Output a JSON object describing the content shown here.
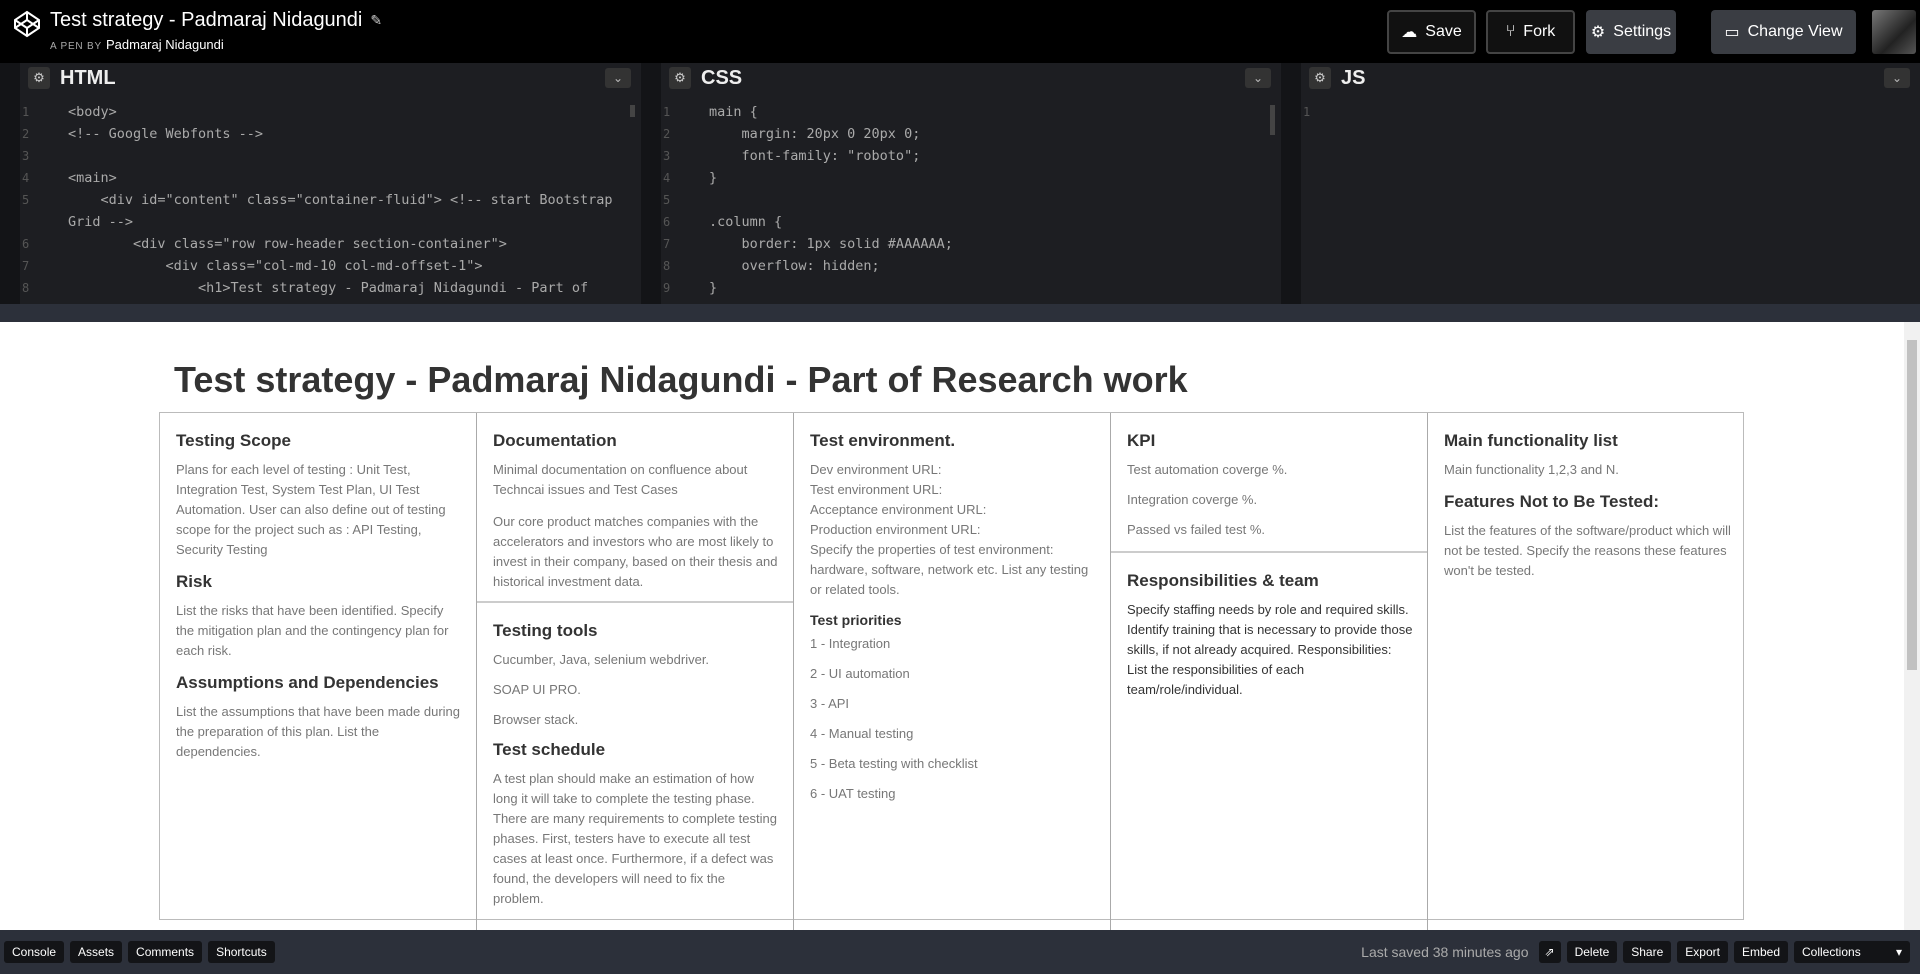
{
  "header": {
    "title": "Test strategy - Padmaraj Nidagundi",
    "pen_by_label": "A PEN BY",
    "author": "Padmaraj Nidagundi",
    "buttons": {
      "save": "Save",
      "fork": "Fork",
      "settings": "Settings",
      "change_view": "Change View"
    }
  },
  "editors": {
    "html": {
      "title": "HTML",
      "lines": [
        {
          "n": "1",
          "text": "<body>"
        },
        {
          "n": "2",
          "text": "<!-- Google Webfonts -->"
        },
        {
          "n": "3",
          "text": ""
        },
        {
          "n": "4",
          "text": "<main>"
        },
        {
          "n": "5",
          "text": "    <div id=\"content\" class=\"container-fluid\"> <!-- start Bootstrap"
        },
        {
          "n": "",
          "text": "Grid -->"
        },
        {
          "n": "6",
          "text": "        <div class=\"row row-header section-container\">"
        },
        {
          "n": "7",
          "text": "            <div class=\"col-md-10 col-md-offset-1\">"
        },
        {
          "n": "8",
          "text": "                <h1>Test strategy - Padmaraj Nidagundi - Part of"
        }
      ]
    },
    "css": {
      "title": "CSS",
      "lines": [
        {
          "n": "1",
          "text": "main {"
        },
        {
          "n": "2",
          "text": "    margin: 20px 0 20px 0;"
        },
        {
          "n": "3",
          "text": "    font-family: \"roboto\";"
        },
        {
          "n": "4",
          "text": "}"
        },
        {
          "n": "5",
          "text": ""
        },
        {
          "n": "6",
          "text": ".column {"
        },
        {
          "n": "7",
          "text": "    border: 1px solid #AAAAAA;"
        },
        {
          "n": "8",
          "text": "    overflow: hidden;"
        },
        {
          "n": "9",
          "text": "}"
        }
      ]
    },
    "js": {
      "title": "JS",
      "lines": [
        {
          "n": "1",
          "text": ""
        }
      ]
    }
  },
  "preview": {
    "title": "Test strategy - Padmaraj Nidagundi - Part of Research work",
    "col1": {
      "scope_h": "Testing Scope",
      "scope_p": "Plans for each level of testing : Unit Test, Integration Test, System Test Plan, UI Test Automation. User can also define out of testing scope for the project such as : API Testing, Security Testing",
      "risk_h": "Risk",
      "risk_p": "List the risks that have been identified. Specify the mitigation plan and the contingency plan for each risk.",
      "assume_h": "Assumptions and Dependencies",
      "assume_p": "List the assumptions that have been made during the preparation of this plan. List the dependencies."
    },
    "col2": {
      "doc_h": "Documentation",
      "doc_p1": "Minimal documentation on confluence about Techncai issues and Test Cases",
      "doc_p2": "Our core product matches companies with the accelerators and investors who are most likely to invest in their company, based on their thesis and historical investment data.",
      "tools_h": "Testing tools",
      "tools_1": "Cucumber, Java, selenium webdriver.",
      "tools_2": "SOAP UI PRO.",
      "tools_3": "Browser stack.",
      "sched_h": "Test schedule",
      "sched_p": "A test plan should make an estimation of how long it will take to complete the testing phase. There are many requirements to complete testing phases. First, testers have to execute all test cases at least once. Furthermore, if a defect was found, the developers will need to fix the problem."
    },
    "col3": {
      "env_h": "Test environment.",
      "env_1": "Dev environment URL:",
      "env_2": "Test environment URL:",
      "env_3": "Acceptance environment URL:",
      "env_4": "Production environment URL:",
      "env_5": "Specify the properties of test environment: hardware, software, network etc. List any testing or related tools.",
      "prio_h": "Test priorities",
      "prio_1": "1 - Integration",
      "prio_2": "2 - UI automation",
      "prio_3": "3 - API",
      "prio_4": "4 - Manual testing",
      "prio_5": "5 - Beta testing with checklist",
      "prio_6": "6 - UAT testing"
    },
    "col4": {
      "kpi_h": "KPI",
      "kpi_1": "Test automation coverge %.",
      "kpi_2": "Integration coverge %.",
      "kpi_3": "Passed vs failed test %.",
      "team_h": "Responsibilities & team",
      "team_p": "Specify staffing needs by role and required skills. Identify training that is necessary to provide those skills, if not already acquired. Responsibilities: List the responsibilities of each team/role/individual."
    },
    "col5": {
      "main_h": "Main functionality list",
      "main_p": "Main functionality 1,2,3 and N.",
      "notest_h": "Features Not to Be Tested:",
      "notest_p": "List the features of the software/product which will not be tested. Specify the reasons these features won't be tested."
    }
  },
  "footer": {
    "left": [
      "Console",
      "Assets",
      "Comments",
      "Shortcuts"
    ],
    "saved": "Last saved 38 minutes ago",
    "right": [
      "Delete",
      "Share",
      "Export",
      "Embed"
    ],
    "collections": "Collections"
  }
}
